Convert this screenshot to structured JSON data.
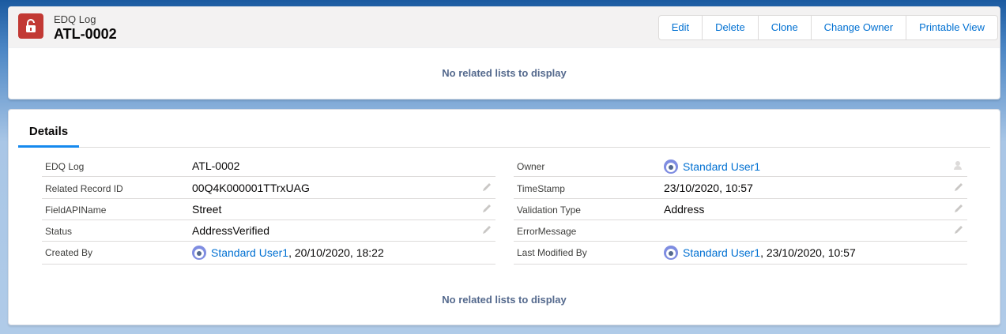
{
  "header": {
    "object_label": "EDQ Log",
    "record_name": "ATL-0002",
    "buttons": [
      "Edit",
      "Delete",
      "Clone",
      "Change Owner",
      "Printable View"
    ],
    "no_related": "No related lists to display"
  },
  "details": {
    "tab_label": "Details",
    "left_fields": [
      {
        "label": "EDQ Log",
        "value": "ATL-0002"
      },
      {
        "label": "Related Record ID",
        "value": "00Q4K000001TTrxUAG"
      },
      {
        "label": "FieldAPIName",
        "value": "Street"
      },
      {
        "label": "Status",
        "value": "AddressVerified"
      },
      {
        "label": "Created By",
        "value_link": "Standard User1",
        "value_suffix": ", 20/10/2020, 18:22"
      }
    ],
    "right_fields": [
      {
        "label": "Owner",
        "value_link": "Standard User1"
      },
      {
        "label": "TimeStamp",
        "value": "23/10/2020, 10:57"
      },
      {
        "label": "Validation Type",
        "value": "Address"
      },
      {
        "label": "ErrorMessage",
        "value": ""
      },
      {
        "label": "Last Modified By",
        "value_link": "Standard User1",
        "value_suffix": ", 23/10/2020, 10:57"
      }
    ],
    "no_related": "No related lists to display"
  },
  "icons": {
    "record": "lock-icon",
    "edit": "pencil-icon",
    "change_owner": "change-owner-icon",
    "avatar": "user-avatar-icon"
  },
  "colors": {
    "record_icon_bg": "#c23934",
    "link": "#0070d2",
    "tab_underline": "#1589ee"
  }
}
